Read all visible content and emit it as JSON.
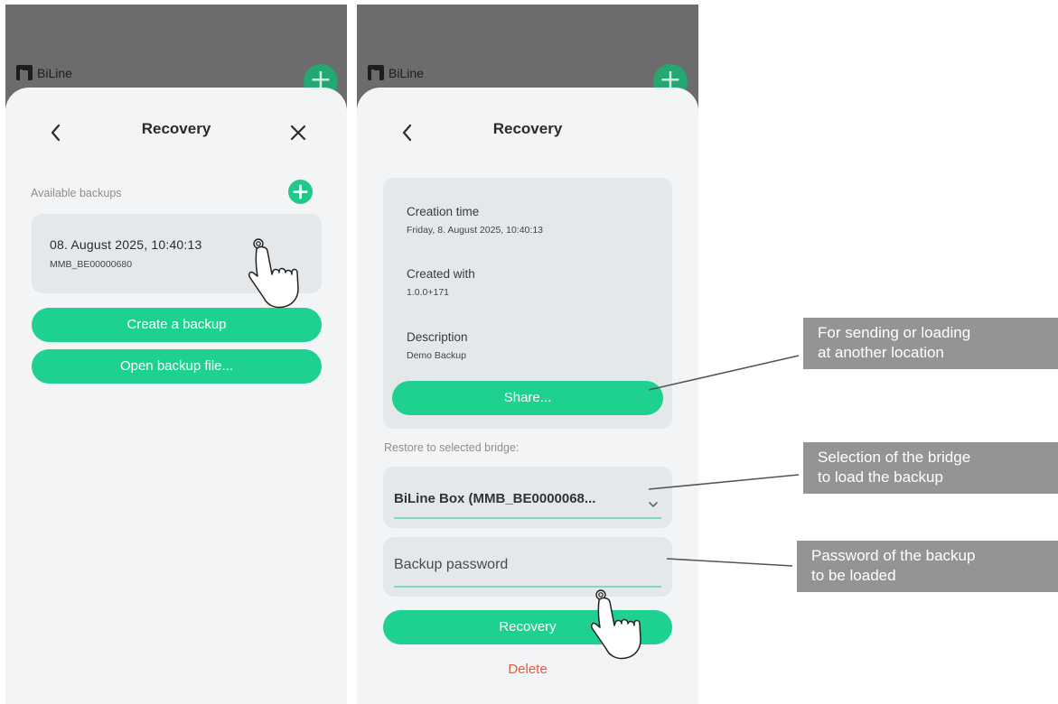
{
  "app": {
    "name": "BiLine"
  },
  "screen1": {
    "title": "Recovery",
    "available_backups_label": "Available backups",
    "backup_item": {
      "date": "08. August 2025, 10:40:13",
      "bridge_id": "MMB_BE00000680"
    },
    "create_backup_label": "Create a backup",
    "open_backup_file_label": "Open backup file..."
  },
  "screen2": {
    "title": "Recovery",
    "creation_time_label": "Creation time",
    "creation_time_value": "Friday, 8. August 2025, 10:40:13",
    "created_with_label": "Created with",
    "created_with_value": "1.0.0+171",
    "description_label": "Description",
    "description_value": "Demo Backup",
    "share_label": "Share...",
    "restore_label": "Restore to selected bridge:",
    "selected_bridge": "BiLine Box (MMB_BE0000068...",
    "password_placeholder": "Backup password",
    "recovery_label": "Recovery",
    "delete_label": "Delete"
  },
  "annotations": {
    "share_note": [
      "For sending or loading",
      "at another location"
    ],
    "bridge_note": [
      "Selection of the bridge",
      "to load the backup"
    ],
    "password_note": [
      "Password of the backup",
      "to be loaded"
    ]
  },
  "icons": {
    "back": "chevron-left-icon",
    "close": "close-icon",
    "add": "plus-circle-icon",
    "dropdown": "chevron-down-icon",
    "logo": "biline-logo-icon",
    "pointer": "hand-pointer-icon"
  },
  "colors": {
    "accent_green": "#1fd191",
    "dark_green": "#24a86f",
    "card_bg": "#e5e8ea",
    "sheet_bg": "#f2f4f6",
    "delete_red": "#e8593a",
    "overlay_gray": "#6c6c6e",
    "callout_gray": "#949494"
  }
}
